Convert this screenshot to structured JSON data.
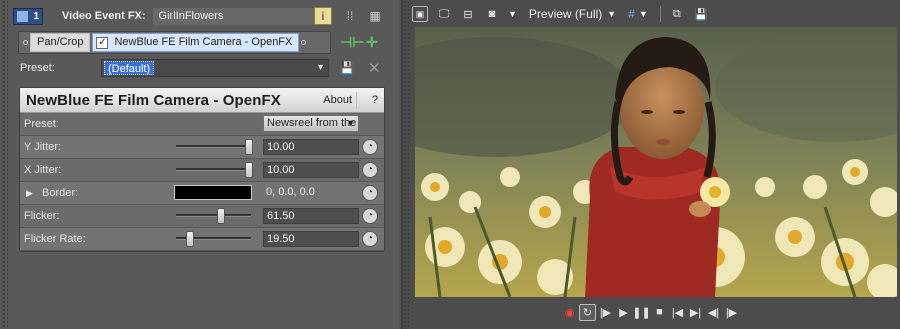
{
  "fx_window": {
    "track_number": "1",
    "title_label": "Video Event FX:",
    "event_name": "GirlInFlowers",
    "header_icons": [
      "info-icon",
      "split-view-icon",
      "grid-view-icon"
    ],
    "chain": {
      "items": [
        {
          "label": "Pan/Crop",
          "selected": false
        },
        {
          "label": "NewBlue FE Film Camera - OpenFX",
          "selected": true,
          "checked": true
        }
      ],
      "add_icon": "plug-in-chain-icon",
      "remove_icon": "remove-plug-in-icon"
    },
    "preset": {
      "label": "Preset:",
      "value": "(Default)"
    }
  },
  "plugin": {
    "name": "NewBlue FE Film Camera - OpenFX",
    "about_label": "About",
    "help_label": "?",
    "params": [
      {
        "label": "Preset:",
        "type": "dropdown",
        "value": "Newsreel from the"
      },
      {
        "label": "Y Jitter:",
        "type": "slider",
        "value": "10.00",
        "level": 1.0
      },
      {
        "label": "X Jitter:",
        "type": "slider",
        "value": "10.00",
        "level": 1.0
      },
      {
        "label": "Border:",
        "type": "color",
        "value": "0, 0.0, 0.0",
        "swatch": "#000000"
      },
      {
        "label": "Flicker:",
        "type": "slider",
        "value": "61.50",
        "level": 0.615
      },
      {
        "label": "Flicker Rate:",
        "type": "slider",
        "value": "19.50",
        "level": 0.195
      }
    ]
  },
  "preview": {
    "quality_label": "Preview (Full)",
    "toolbar_icons": [
      "properties-icon",
      "external-monitor-icon",
      "split-screen-icon",
      "overlay-icon",
      "grid-icon",
      "copy-snapshot-icon",
      "save-snapshot-icon"
    ],
    "transport_icons": [
      "record-icon",
      "loop-icon",
      "play-from-start-icon",
      "play-icon",
      "pause-icon",
      "stop-icon",
      "prev-marker-icon",
      "next-marker-icon",
      "prev-frame-icon",
      "next-frame-icon"
    ]
  },
  "colors": {
    "accent_blue": "#3a6fd0",
    "record_red": "#ff3b3b",
    "chain_green": "#5fc15f"
  }
}
